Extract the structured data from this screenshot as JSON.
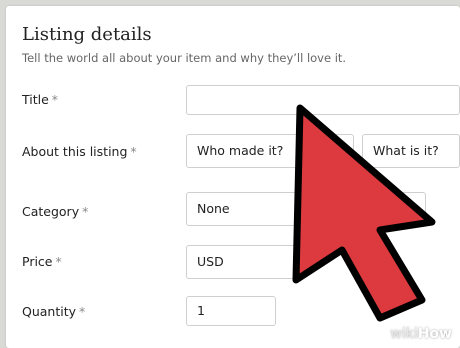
{
  "section": {
    "title": "Listing details",
    "subtitle": "Tell the world all about your item and why they’ll love it."
  },
  "fields": {
    "title": {
      "label": "Title",
      "required_mark": "*",
      "value": ""
    },
    "about": {
      "label": "About this listing",
      "required_mark": "*",
      "who_made": "Who made it?",
      "what_is": "What is it?"
    },
    "category": {
      "label": "Category",
      "required_mark": "*",
      "value": "None"
    },
    "price": {
      "label": "Price",
      "required_mark": "*",
      "currency": "USD"
    },
    "quantity": {
      "label": "Quantity",
      "required_mark": "*",
      "value": "1"
    }
  },
  "watermark": {
    "prefix": "wiki",
    "suffix": "How"
  },
  "colors": {
    "arrow_fill": "#dc3a3e",
    "arrow_stroke": "#000000"
  }
}
